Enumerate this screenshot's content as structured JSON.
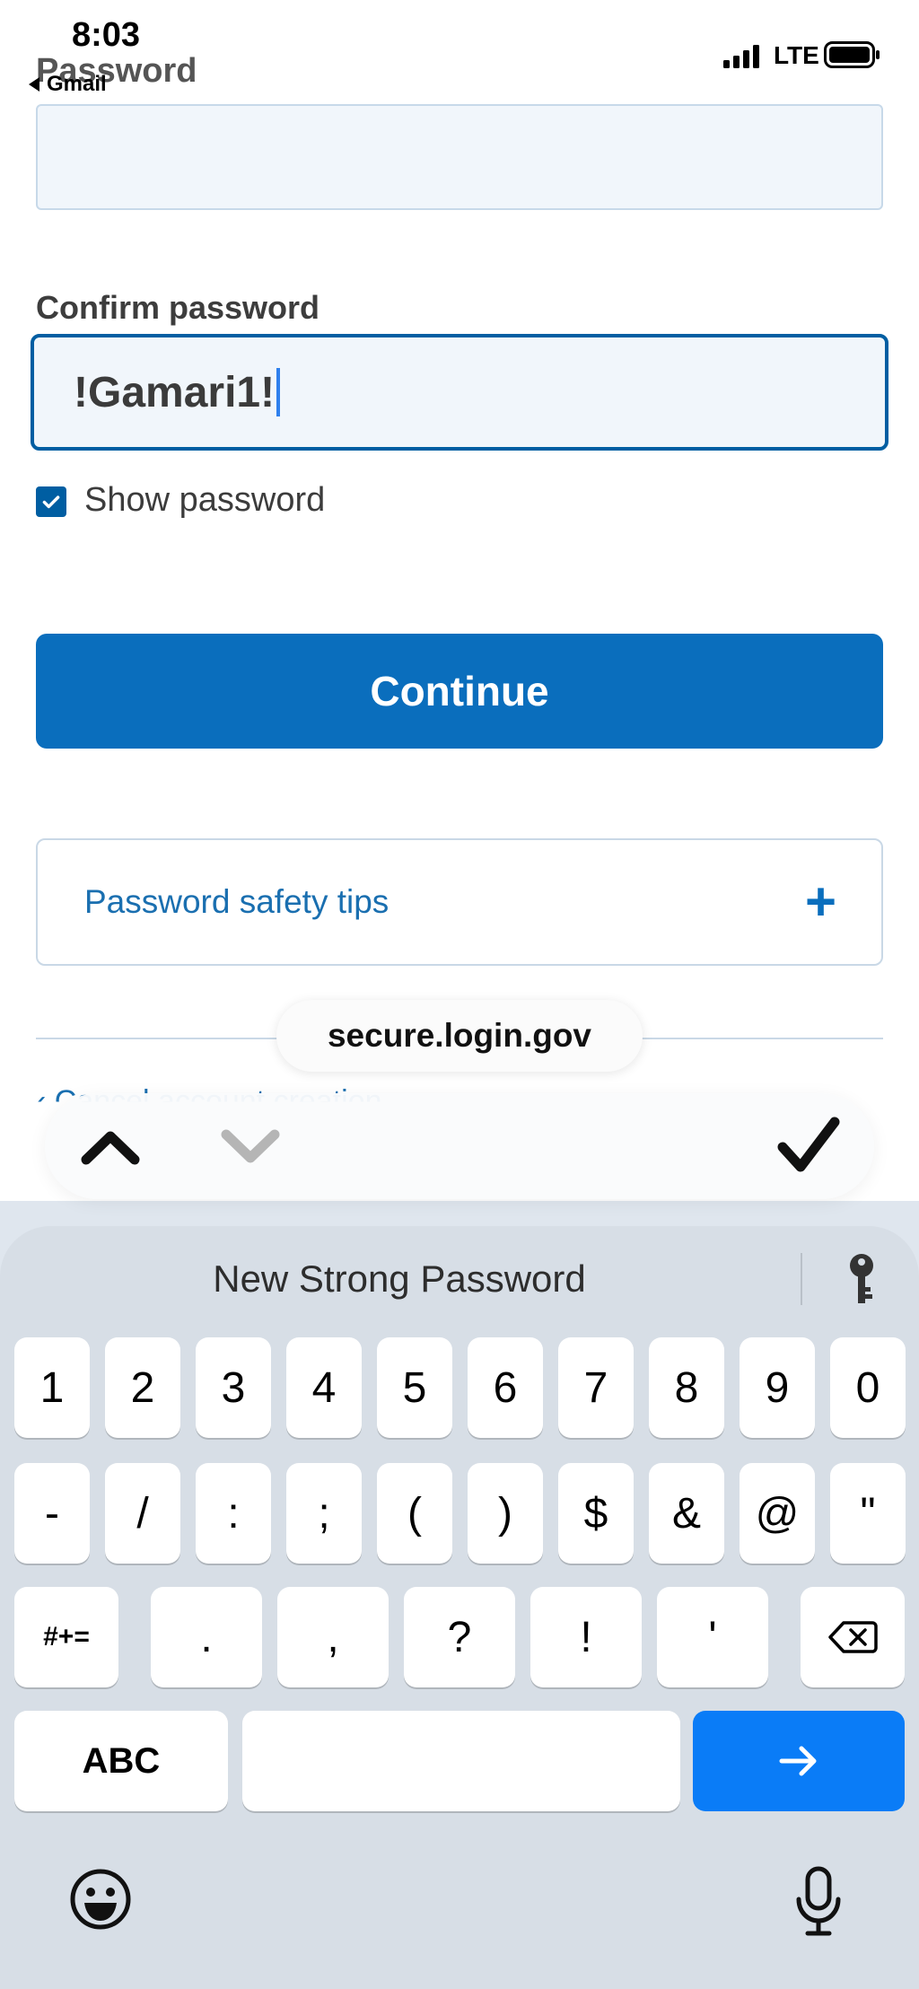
{
  "status_bar": {
    "time": "8:03",
    "back_app": "Gmail",
    "network": "LTE"
  },
  "form": {
    "password_label": "Password",
    "password_value": "",
    "confirm_label": "Confirm password",
    "confirm_value": "!Gamari1!",
    "show_password_label": "Show password",
    "show_password_checked": true,
    "continue_label": "Continue",
    "safety_tips_label": "Password safety tips",
    "safety_tips_toggle": "+",
    "cancel_link_label": "‹ Cancel account creation"
  },
  "browser": {
    "url": "secure.login.gov"
  },
  "keyboard": {
    "suggestion": "New Strong Password",
    "row1": [
      "1",
      "2",
      "3",
      "4",
      "5",
      "6",
      "7",
      "8",
      "9",
      "0"
    ],
    "row2": [
      "-",
      "/",
      ":",
      ";",
      "(",
      ")",
      "$",
      "&",
      "@",
      "\""
    ],
    "row3": [
      "#+=",
      ".",
      ",",
      "?",
      "!",
      "'"
    ],
    "row4_left": "ABC",
    "return_icon": "arrow-right-icon"
  },
  "colors": {
    "primary": "#0a6ebd",
    "focus_border": "#005ea2",
    "link": "#1a6fb0",
    "return_key": "#0a7cf7"
  }
}
